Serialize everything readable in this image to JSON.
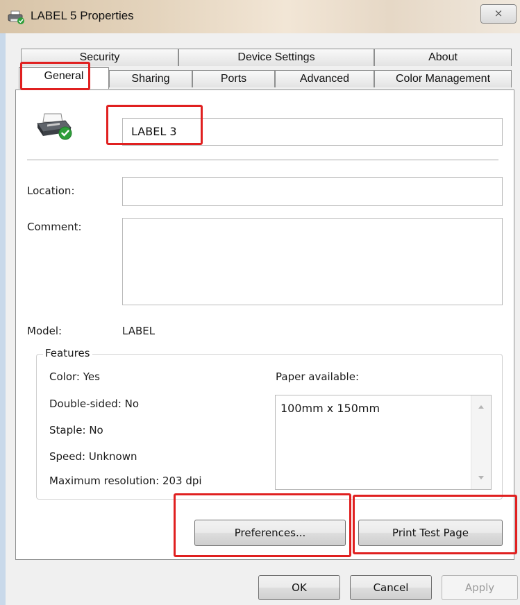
{
  "window": {
    "title": "LABEL 5 Properties",
    "close_glyph": "⨯"
  },
  "tabs": {
    "row1": [
      "Security",
      "Device Settings",
      "About"
    ],
    "row2": [
      "General",
      "Sharing",
      "Ports",
      "Advanced",
      "Color Management"
    ],
    "active": "General"
  },
  "general": {
    "printer_name": "LABEL 3",
    "location_label": "Location:",
    "location_value": "",
    "comment_label": "Comment:",
    "comment_value": "",
    "model_label": "Model:",
    "model_value": "LABEL"
  },
  "features": {
    "title": "Features",
    "items": [
      "Color: Yes",
      "Double-sided: No",
      "Staple: No",
      "Speed: Unknown",
      "Maximum resolution: 203 dpi"
    ],
    "paper_label": "Paper available:",
    "paper_options": [
      "100mm x 150mm"
    ]
  },
  "buttons": {
    "preferences": "Preferences...",
    "print_test_page": "Print Test Page",
    "ok": "OK",
    "cancel": "Cancel",
    "apply": "Apply"
  },
  "colors": {
    "annotation_red": "#e02020",
    "status_ok_green": "#2e9e3a"
  },
  "icons": {
    "title": "printer-icon",
    "printer": "printer-ok-icon"
  }
}
